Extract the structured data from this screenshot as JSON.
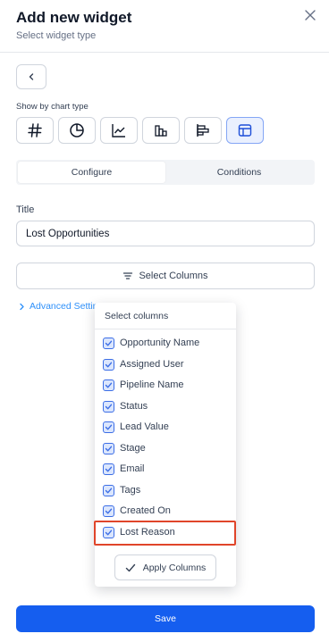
{
  "header": {
    "title": "Add new widget",
    "subtitle": "Select widget type",
    "close_icon": "close-icon"
  },
  "chart_type": {
    "label": "Show by chart type",
    "types": [
      {
        "name": "number",
        "icon": "hash-icon"
      },
      {
        "name": "pie",
        "icon": "pie-chart-icon"
      },
      {
        "name": "line",
        "icon": "line-chart-icon"
      },
      {
        "name": "bar",
        "icon": "bar-chart-icon"
      },
      {
        "name": "horizontal-bar",
        "icon": "horizontal-bar-chart-icon"
      },
      {
        "name": "table",
        "icon": "table-icon",
        "selected": true
      }
    ]
  },
  "tabs": [
    {
      "label": "Configure",
      "active": true
    },
    {
      "label": "Conditions",
      "active": false
    }
  ],
  "title_field": {
    "label": "Title",
    "value": "Lost Opportunities"
  },
  "select_columns": {
    "label": "Select Columns",
    "icon": "filter-lines-icon"
  },
  "advanced": {
    "label": "Advanced Settings"
  },
  "dropdown": {
    "title": "Select columns",
    "items": [
      {
        "label": "Opportunity Name",
        "checked": true
      },
      {
        "label": "Assigned User",
        "checked": true
      },
      {
        "label": "Pipeline Name",
        "checked": true
      },
      {
        "label": "Status",
        "checked": true
      },
      {
        "label": "Lead Value",
        "checked": true
      },
      {
        "label": "Stage",
        "checked": true
      },
      {
        "label": "Email",
        "checked": true
      },
      {
        "label": "Tags",
        "checked": true
      },
      {
        "label": "Created On",
        "checked": true
      },
      {
        "label": "Lost Reason",
        "checked": true
      }
    ],
    "apply_label": "Apply Columns"
  },
  "footer": {
    "save_label": "Save"
  },
  "colors": {
    "primary": "#155eef",
    "link": "#2e90fa",
    "highlight": "#e0452a",
    "checkbox": "#3c6ee6"
  }
}
